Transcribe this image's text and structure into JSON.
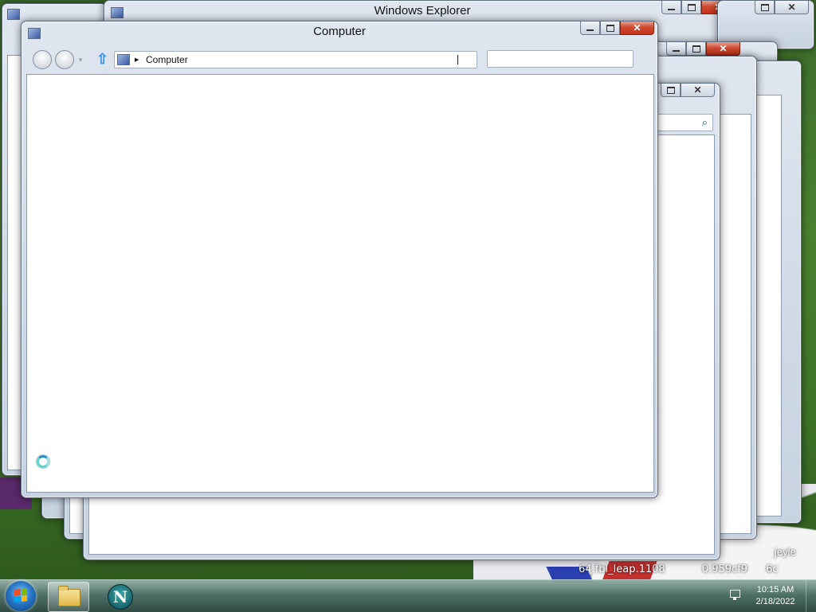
{
  "back_windows": {
    "window_1_title": "Windows Explorer"
  },
  "front_window": {
    "title": "Computer",
    "breadcrumb": [
      "Computer"
    ],
    "search_value": "",
    "icons": {
      "back": "back-arrow-icon",
      "forward": "forward-arrow-icon",
      "up": "up-arrow-icon",
      "location": "computer-icon",
      "busy": "busy-spinner-icon"
    }
  },
  "search_glyph": "⌕",
  "wallpaper": {
    "text_line_1": "64.fbl_leap.1108",
    "text_line_1b": "0.959cf9",
    "text_line_1c": "6c",
    "text_line_2": "jeyle"
  },
  "taskbar": {
    "start_label": "Start",
    "pinned": [
      {
        "name": "Windows Explorer",
        "icon": "folder-icon"
      },
      {
        "name": "Netscape",
        "icon": "netscape-icon",
        "glyph": "N"
      }
    ],
    "clock_time": "10:15 AM",
    "clock_date": "2/18/2022"
  },
  "colors": {
    "close_button": "#c1331b",
    "accent": "#3a8ee6",
    "desktop_green": "#4a8030"
  }
}
